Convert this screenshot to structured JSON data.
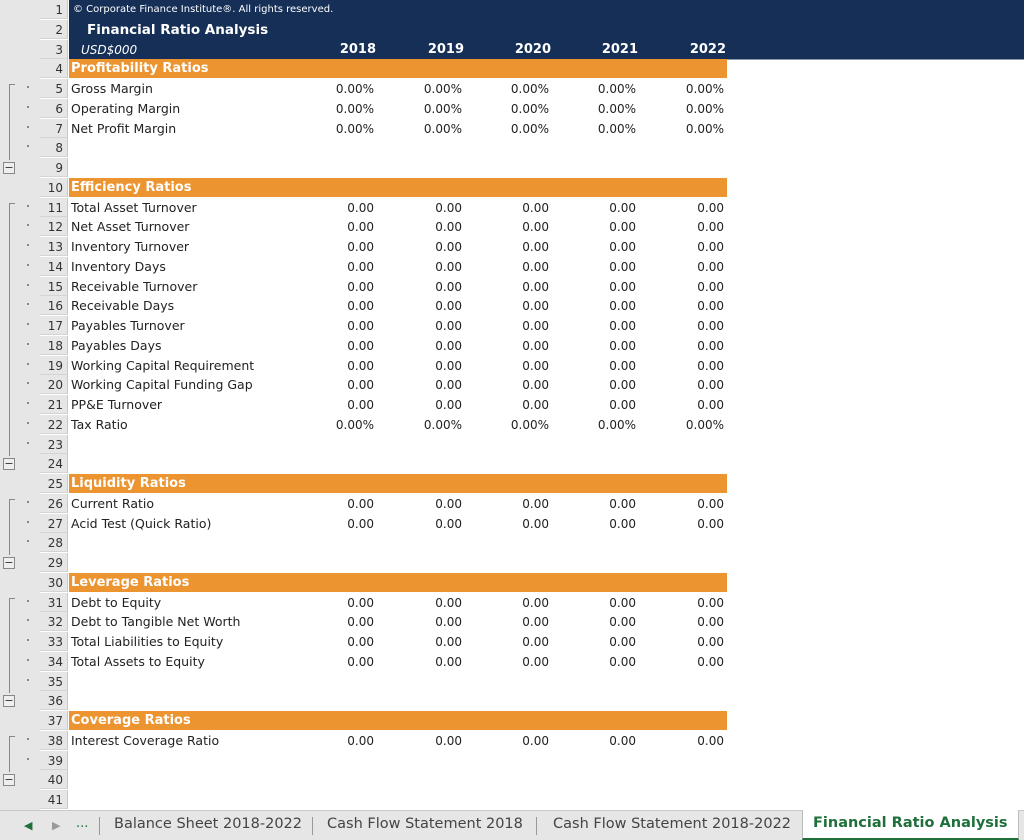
{
  "header": {
    "copyright": "© Corporate Finance Institute®. All rights reserved.",
    "title": "Financial Ratio Analysis",
    "unit": "USD$000",
    "years": [
      "2018",
      "2019",
      "2020",
      "2021",
      "2022"
    ]
  },
  "sections": [
    {
      "row": 4,
      "title": "Profitability Ratios",
      "items": [
        {
          "row": 5,
          "label": "Gross Margin",
          "values": [
            "0.00%",
            "0.00%",
            "0.00%",
            "0.00%",
            "0.00%"
          ]
        },
        {
          "row": 6,
          "label": "Operating Margin",
          "values": [
            "0.00%",
            "0.00%",
            "0.00%",
            "0.00%",
            "0.00%"
          ]
        },
        {
          "row": 7,
          "label": "Net Profit Margin",
          "values": [
            "0.00%",
            "0.00%",
            "0.00%",
            "0.00%",
            "0.00%"
          ]
        }
      ]
    },
    {
      "row": 10,
      "title": "Efficiency Ratios",
      "items": [
        {
          "row": 11,
          "label": "Total Asset Turnover",
          "values": [
            "0.00",
            "0.00",
            "0.00",
            "0.00",
            "0.00"
          ]
        },
        {
          "row": 12,
          "label": "Net Asset Turnover",
          "values": [
            "0.00",
            "0.00",
            "0.00",
            "0.00",
            "0.00"
          ]
        },
        {
          "row": 13,
          "label": "Inventory Turnover",
          "values": [
            "0.00",
            "0.00",
            "0.00",
            "0.00",
            "0.00"
          ]
        },
        {
          "row": 14,
          "label": "Inventory Days",
          "values": [
            "0.00",
            "0.00",
            "0.00",
            "0.00",
            "0.00"
          ]
        },
        {
          "row": 15,
          "label": "Receivable Turnover",
          "values": [
            "0.00",
            "0.00",
            "0.00",
            "0.00",
            "0.00"
          ]
        },
        {
          "row": 16,
          "label": "Receivable Days",
          "values": [
            "0.00",
            "0.00",
            "0.00",
            "0.00",
            "0.00"
          ]
        },
        {
          "row": 17,
          "label": "Payables Turnover",
          "values": [
            "0.00",
            "0.00",
            "0.00",
            "0.00",
            "0.00"
          ]
        },
        {
          "row": 18,
          "label": "Payables Days",
          "values": [
            "0.00",
            "0.00",
            "0.00",
            "0.00",
            "0.00"
          ]
        },
        {
          "row": 19,
          "label": "Working Capital Requirement",
          "values": [
            "0.00",
            "0.00",
            "0.00",
            "0.00",
            "0.00"
          ]
        },
        {
          "row": 20,
          "label": "Working Capital Funding Gap",
          "values": [
            "0.00",
            "0.00",
            "0.00",
            "0.00",
            "0.00"
          ]
        },
        {
          "row": 21,
          "label": "PP&E Turnover",
          "values": [
            "0.00",
            "0.00",
            "0.00",
            "0.00",
            "0.00"
          ]
        },
        {
          "row": 22,
          "label": "Tax Ratio",
          "values": [
            "0.00%",
            "0.00%",
            "0.00%",
            "0.00%",
            "0.00%"
          ]
        }
      ]
    },
    {
      "row": 25,
      "title": "Liquidity Ratios",
      "items": [
        {
          "row": 26,
          "label": "Current Ratio",
          "values": [
            "0.00",
            "0.00",
            "0.00",
            "0.00",
            "0.00"
          ]
        },
        {
          "row": 27,
          "label": "Acid Test (Quick Ratio)",
          "values": [
            "0.00",
            "0.00",
            "0.00",
            "0.00",
            "0.00"
          ]
        }
      ]
    },
    {
      "row": 30,
      "title": "Leverage Ratios",
      "items": [
        {
          "row": 31,
          "label": "Debt to Equity",
          "values": [
            "0.00",
            "0.00",
            "0.00",
            "0.00",
            "0.00"
          ]
        },
        {
          "row": 32,
          "label": "Debt to Tangible Net Worth",
          "values": [
            "0.00",
            "0.00",
            "0.00",
            "0.00",
            "0.00"
          ]
        },
        {
          "row": 33,
          "label": "Total Liabilities to Equity",
          "values": [
            "0.00",
            "0.00",
            "0.00",
            "0.00",
            "0.00"
          ]
        },
        {
          "row": 34,
          "label": "Total Assets to Equity",
          "values": [
            "0.00",
            "0.00",
            "0.00",
            "0.00",
            "0.00"
          ]
        }
      ]
    },
    {
      "row": 37,
      "title": "Coverage Ratios",
      "items": [
        {
          "row": 38,
          "label": "Interest Coverage Ratio",
          "values": [
            "0.00",
            "0.00",
            "0.00",
            "0.00",
            "0.00"
          ]
        }
      ]
    }
  ],
  "row_count": 41,
  "outline_groups": [
    {
      "start": 5,
      "collapse_row": 9
    },
    {
      "start": 11,
      "collapse_row": 24
    },
    {
      "start": 26,
      "collapse_row": 29
    },
    {
      "start": 31,
      "collapse_row": 36
    },
    {
      "start": 38,
      "collapse_row": 40
    }
  ],
  "tabs": {
    "nav_prev": "◀",
    "nav_next": "▶",
    "more": "...",
    "sheets": [
      {
        "label": "Balance Sheet 2018-2022",
        "active": false
      },
      {
        "label": "Cash Flow Statement 2018",
        "active": false
      },
      {
        "label": "Cash Flow Statement 2018-2022",
        "active": false
      },
      {
        "label": "Financial Ratio Analysis",
        "active": true
      }
    ]
  },
  "colors": {
    "navy": "#152f57",
    "orange": "#ec9430",
    "active_tab": "#1f6f3b"
  }
}
